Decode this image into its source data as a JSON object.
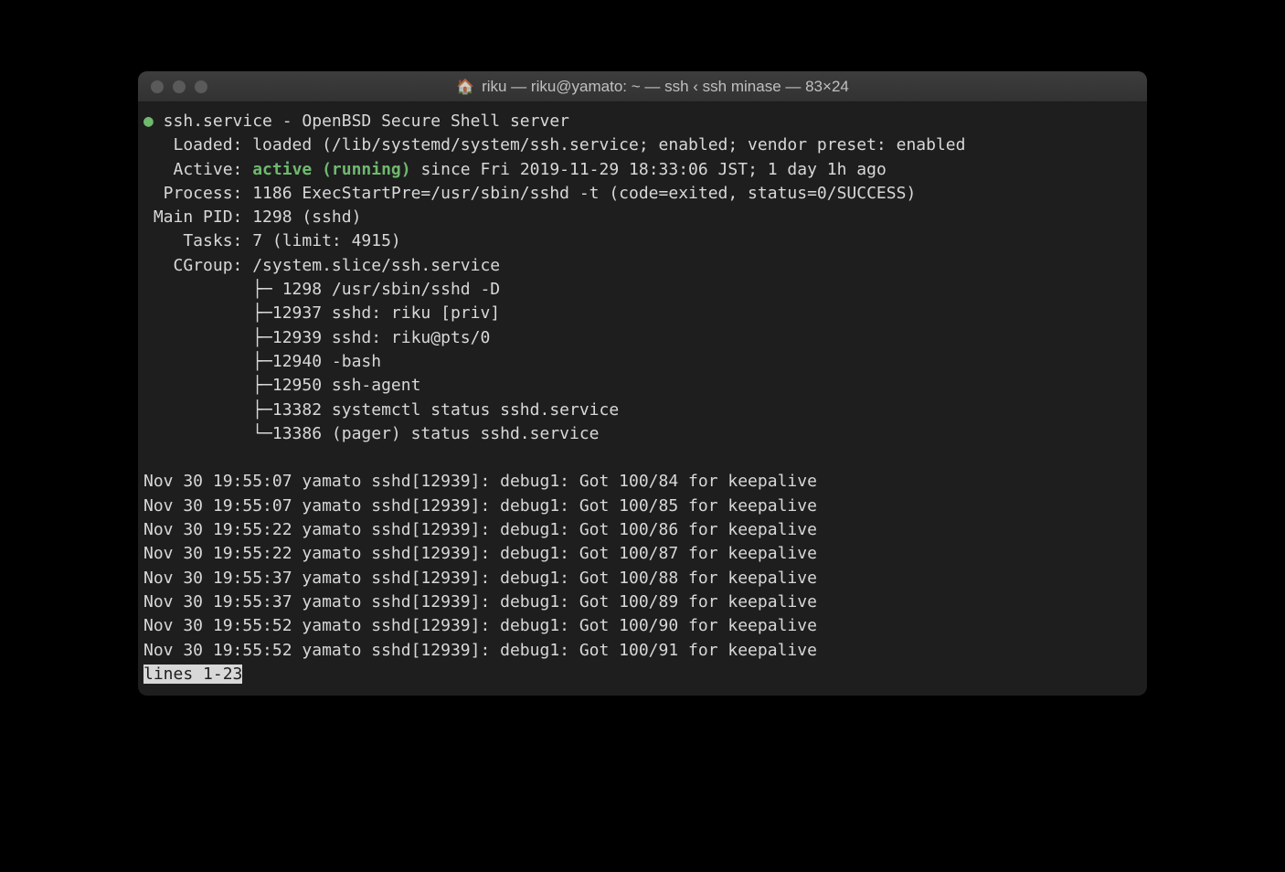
{
  "titlebar": {
    "title": "riku — riku@yamato: ~ — ssh ‹ ssh minase — 83×24"
  },
  "bullet": "●",
  "service": {
    "header": " ssh.service - OpenBSD Secure Shell server",
    "loaded": "   Loaded: loaded (/lib/systemd/system/ssh.service; enabled; vendor preset: enabled",
    "active_label": "   Active: ",
    "active_status": "active (running)",
    "active_since": " since Fri 2019-11-29 18:33:06 JST; 1 day 1h ago",
    "process": "  Process: 1186 ExecStartPre=/usr/sbin/sshd -t (code=exited, status=0/SUCCESS)",
    "mainpid": " Main PID: 1298 (sshd)",
    "tasks": "    Tasks: 7 (limit: 4915)",
    "cgroup": "   CGroup: /system.slice/ssh.service",
    "tree": [
      "           ├─ 1298 /usr/sbin/sshd -D",
      "           ├─12937 sshd: riku [priv]",
      "           ├─12939 sshd: riku@pts/0",
      "           ├─12940 -bash",
      "           ├─12950 ssh-agent",
      "           ├─13382 systemctl status sshd.service",
      "           └─13386 (pager) status sshd.service"
    ]
  },
  "logs": [
    "Nov 30 19:55:07 yamato sshd[12939]: debug1: Got 100/84 for keepalive",
    "Nov 30 19:55:07 yamato sshd[12939]: debug1: Got 100/85 for keepalive",
    "Nov 30 19:55:22 yamato sshd[12939]: debug1: Got 100/86 for keepalive",
    "Nov 30 19:55:22 yamato sshd[12939]: debug1: Got 100/87 for keepalive",
    "Nov 30 19:55:37 yamato sshd[12939]: debug1: Got 100/88 for keepalive",
    "Nov 30 19:55:37 yamato sshd[12939]: debug1: Got 100/89 for keepalive",
    "Nov 30 19:55:52 yamato sshd[12939]: debug1: Got 100/90 for keepalive",
    "Nov 30 19:55:52 yamato sshd[12939]: debug1: Got 100/91 for keepalive"
  ],
  "pager": "lines 1-23"
}
